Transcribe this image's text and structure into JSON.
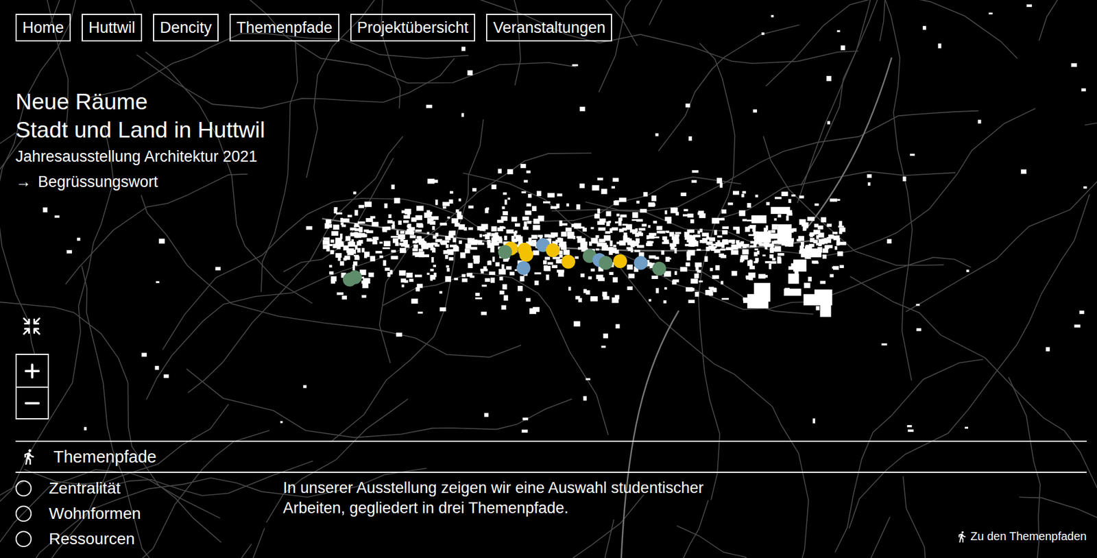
{
  "nav": [
    {
      "label": "Home"
    },
    {
      "label": "Huttwil"
    },
    {
      "label": "Dencity"
    },
    {
      "label": "Themenpfade"
    },
    {
      "label": "Projektübersicht"
    },
    {
      "label": "Veranstaltungen"
    }
  ],
  "hero": {
    "title_lines": [
      "Neue Räume",
      "Stadt und Land in Huttwil"
    ],
    "subtitle": "Jahresausstellung Architektur 2021",
    "link": {
      "arrow": "→",
      "label": "Begrüssungswort"
    }
  },
  "themenpfade": {
    "heading": "Themenpfade",
    "items": [
      {
        "label": "Zentralität",
        "selected": false
      },
      {
        "label": "Wohnformen",
        "selected": false
      },
      {
        "label": "Ressourcen",
        "selected": false
      }
    ],
    "description_lines": [
      "In unserer Ausstellung zeigen wir eine Auswahl studentischer",
      "Arbeiten, gegliedert in drei Themenpfade."
    ],
    "link": "Zu den Themenpfaden"
  },
  "map": {
    "pins": [
      {
        "color": "#f2c200"
      },
      {
        "color": "#f2c200"
      },
      {
        "color": "#f2c200"
      },
      {
        "color": "#6f9dc6"
      },
      {
        "color": "#6f9dc6"
      },
      {
        "color": "#f2c200"
      },
      {
        "color": "#f2c200"
      },
      {
        "color": "#5f8d6b"
      },
      {
        "color": "#6f9dc6"
      },
      {
        "color": "#5f8d6b"
      },
      {
        "color": "#f2c200"
      },
      {
        "color": "#6f9dc6"
      },
      {
        "color": "#5f8d6b"
      },
      {
        "color": "#5f8d6b"
      },
      {
        "color": "#5f8d6b"
      },
      {
        "color": "#5f8d6b"
      }
    ]
  }
}
